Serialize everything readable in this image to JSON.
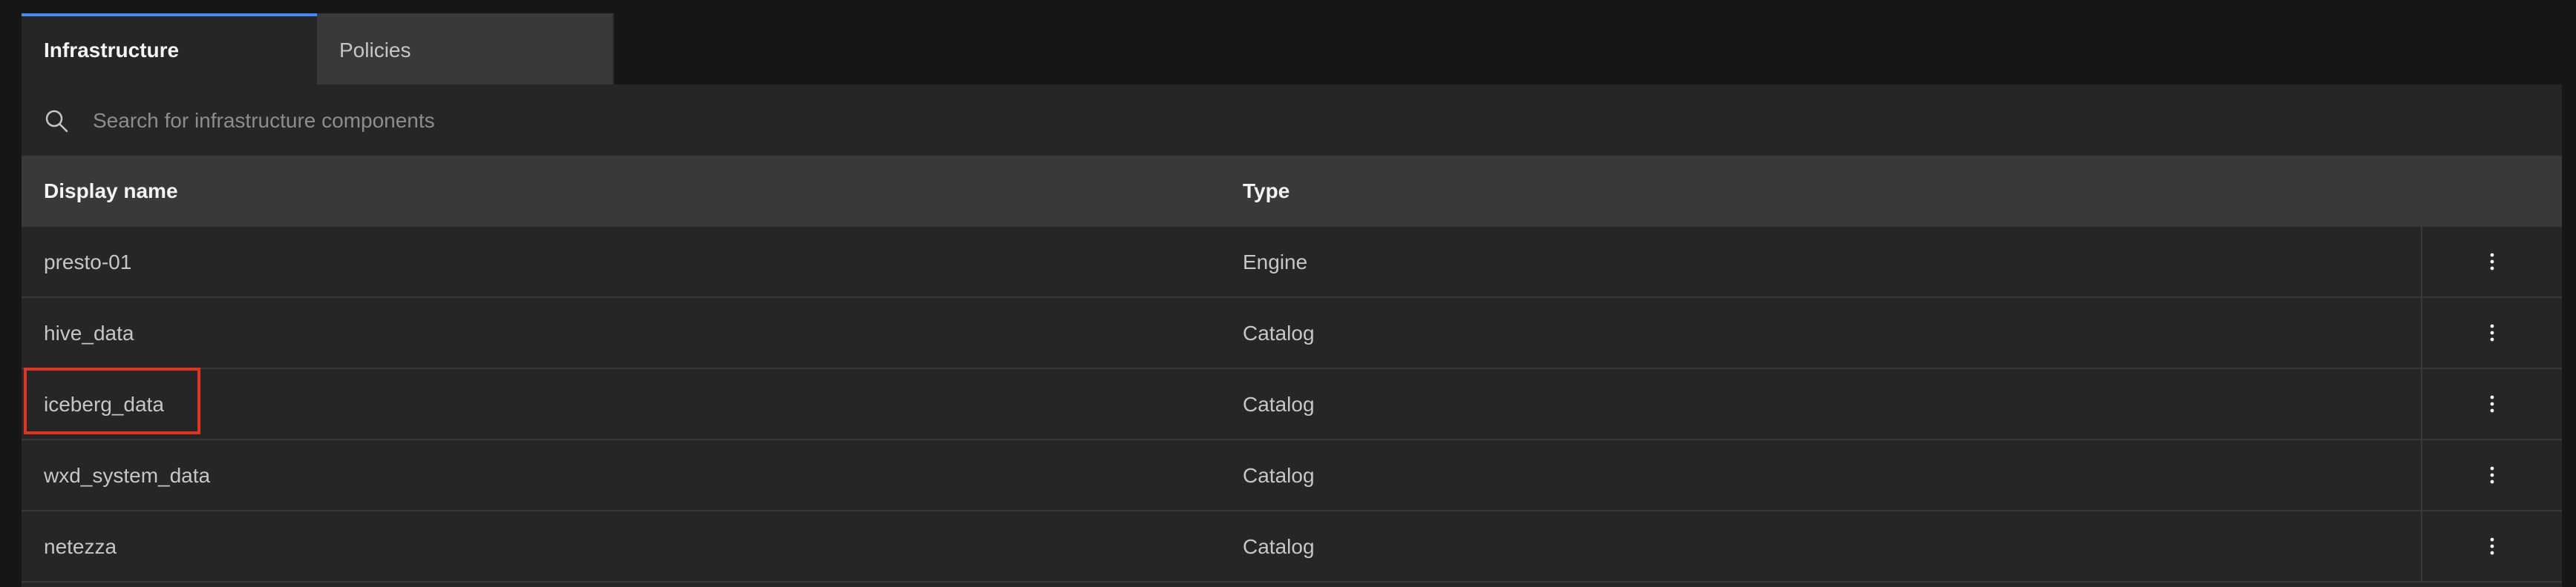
{
  "tabs": [
    {
      "label": "Infrastructure",
      "active": true
    },
    {
      "label": "Policies",
      "active": false
    }
  ],
  "search": {
    "placeholder": "Search for infrastructure components",
    "icon": "search-icon"
  },
  "table": {
    "headers": {
      "display_name": "Display name",
      "type": "Type"
    },
    "rows": [
      {
        "name": "presto-01",
        "type": "Engine"
      },
      {
        "name": "hive_data",
        "type": "Catalog"
      },
      {
        "name": "iceberg_data",
        "type": "Catalog",
        "highlighted": true
      },
      {
        "name": "wxd_system_data",
        "type": "Catalog"
      },
      {
        "name": "netezza",
        "type": "Catalog"
      }
    ],
    "row_action_icon": "overflow-menu-vertical-icon"
  },
  "colors": {
    "background": "#161616",
    "panel": "#262626",
    "header": "#393939",
    "accent": "#4589ff",
    "highlight": "#e0341f"
  }
}
